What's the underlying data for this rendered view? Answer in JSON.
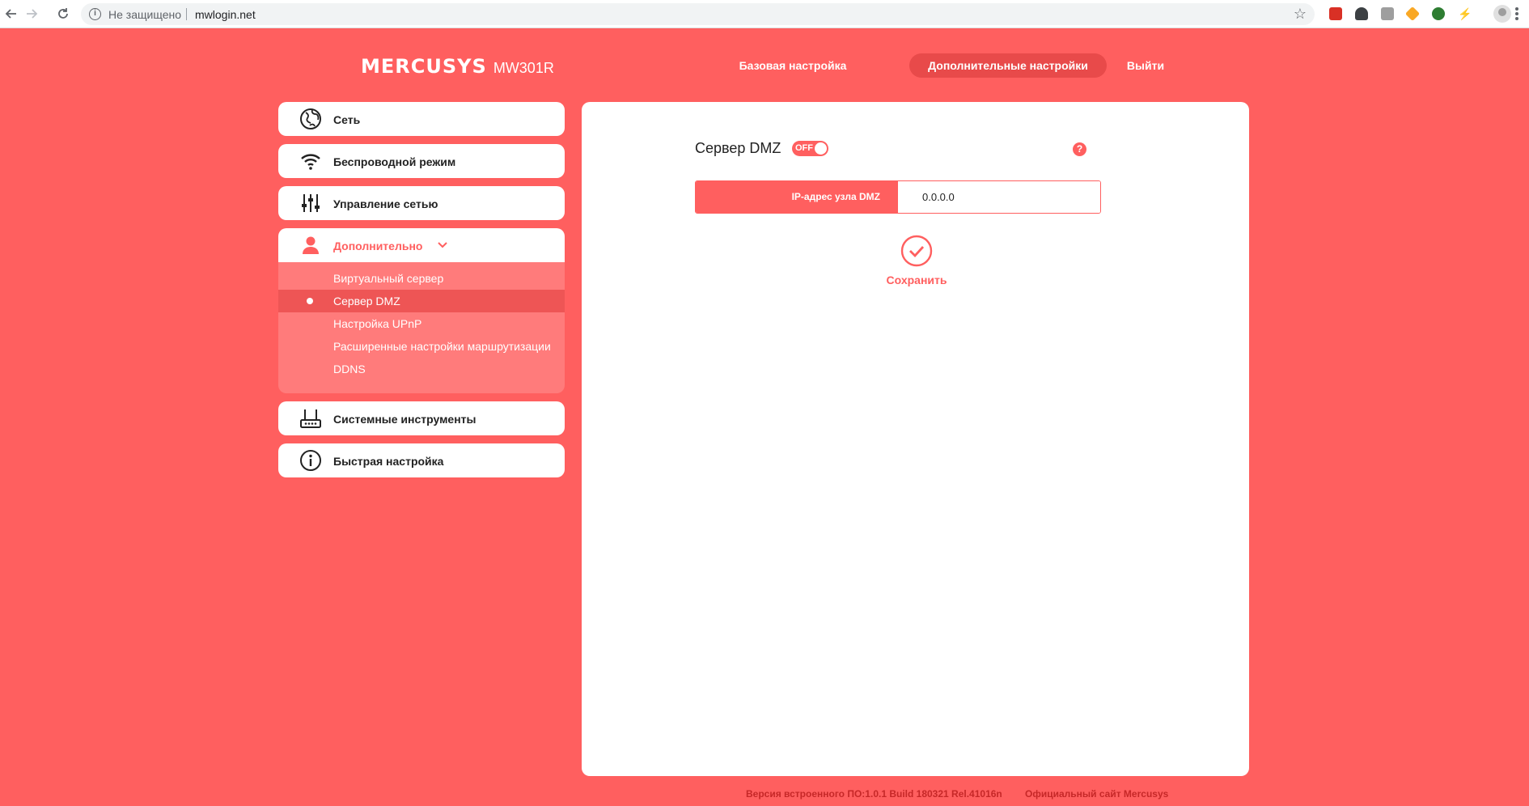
{
  "browser": {
    "security_label": "Не защищено",
    "url": "mwlogin.net"
  },
  "header": {
    "brand": "MERCUSYS",
    "model": "MW301R",
    "nav": [
      {
        "label": "Базовая настройка"
      },
      {
        "label": "Дополнительные настройки"
      },
      {
        "label": "Выйти"
      }
    ]
  },
  "sidebar": {
    "items": [
      {
        "label": "Сеть"
      },
      {
        "label": "Беспроводной режим"
      },
      {
        "label": "Управление сетью"
      },
      {
        "label": "Дополнительно"
      },
      {
        "label": "Системные инструменты"
      },
      {
        "label": "Быстрая настройка"
      }
    ],
    "submenu": [
      {
        "label": "Виртуальный сервер"
      },
      {
        "label": "Сервер DMZ"
      },
      {
        "label": "Настройка UPnP"
      },
      {
        "label": "Расширенные настройки маршрутизации"
      },
      {
        "label": "DDNS"
      }
    ]
  },
  "content": {
    "title": "Сервер DMZ",
    "toggle_label": "OFF",
    "help": "?",
    "ip_label": "IP-адрес узла DMZ",
    "ip_value": "0.0.0.0",
    "save_label": "Сохранить"
  },
  "footer": {
    "firmware": "Версия встроенного ПО:1.0.1 Build 180321 Rel.41016n",
    "official_site": "Официальный сайт Mercusys"
  },
  "colors": {
    "accent": "#ff5f5f",
    "active_nav": "#e84a4a"
  }
}
